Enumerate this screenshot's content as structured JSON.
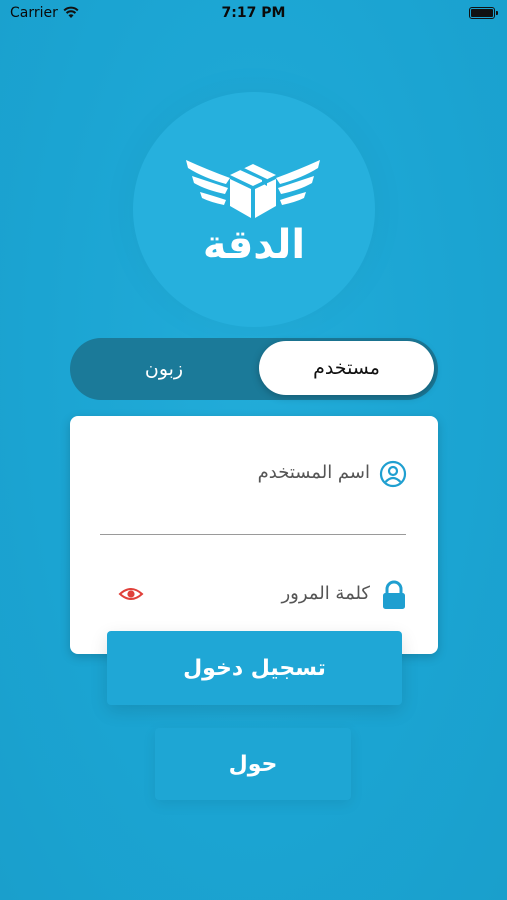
{
  "status_bar": {
    "carrier": "Carrier",
    "time": "7:17 PM"
  },
  "logo": {
    "text": "الدقة"
  },
  "segmented": {
    "active_label": "مستخدم",
    "inactive_label": "زبون"
  },
  "form": {
    "username_placeholder": "اسم المستخدم",
    "password_placeholder": "كلمة المرور"
  },
  "buttons": {
    "login_label": "تسجيل دخول",
    "about_label": "حول"
  },
  "colors": {
    "background": "#1ba4d2",
    "accent": "#1f9fd0",
    "eye_icon": "#e0403a"
  }
}
